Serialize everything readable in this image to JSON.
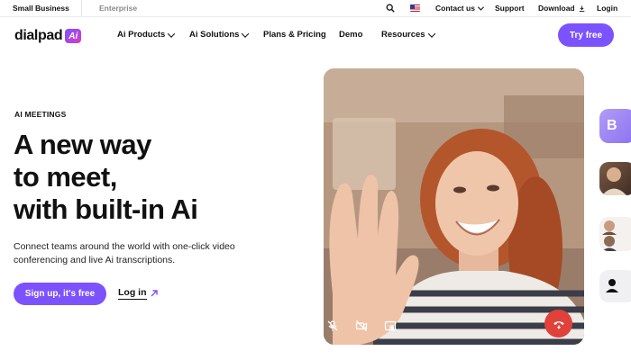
{
  "topbar": {
    "segment_small_business": "Small Business",
    "segment_enterprise": "Enterprise",
    "contact_us": "Contact us",
    "support": "Support",
    "download": "Download",
    "login": "Login"
  },
  "nav": {
    "logo_word": "dialpad",
    "logo_badge": "Ai",
    "items": [
      {
        "label": "Ai Products"
      },
      {
        "label": "Ai Solutions"
      },
      {
        "label": "Plans & Pricing"
      },
      {
        "label": "Demo"
      },
      {
        "label": "Resources"
      }
    ],
    "try_free": "Try free"
  },
  "hero": {
    "eyebrow": "AI MEETINGS",
    "headline_lines": [
      "A new way",
      "to meet,",
      "with built-in Ai"
    ],
    "subtext": "Connect teams around the world with one-click video conferencing and live Ai transcriptions.",
    "signup": "Sign up, it's free",
    "login": "Log in"
  },
  "video": {
    "controls": [
      "mic-off-icon",
      "camera-off-icon",
      "picture-in-picture-icon",
      "hang-up-icon"
    ],
    "hangup_color": "#e0413a"
  },
  "side_tiles": {
    "tile_1_letter": "B"
  },
  "colors": {
    "brand_purple": "#7c52ff",
    "text": "#111111"
  }
}
